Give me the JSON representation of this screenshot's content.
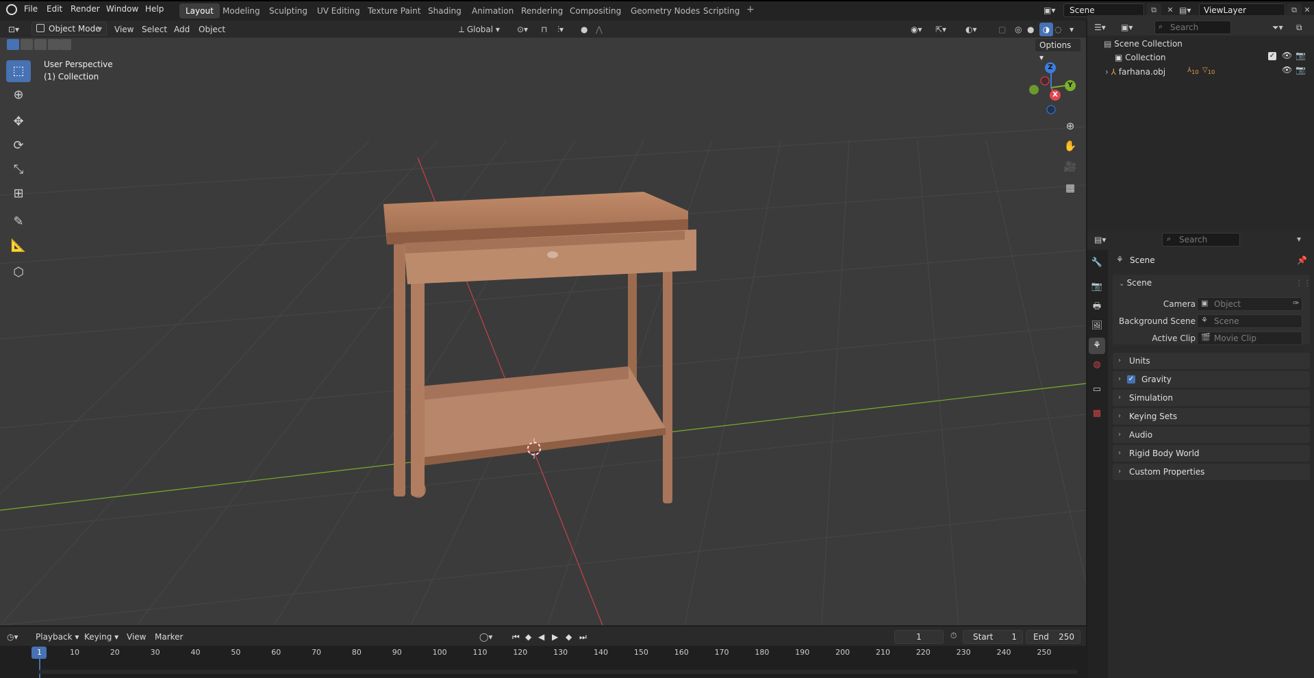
{
  "menu": [
    "File",
    "Edit",
    "Render",
    "Window",
    "Help"
  ],
  "workspaces": [
    "Layout",
    "Modeling",
    "Sculpting",
    "UV Editing",
    "Texture Paint",
    "Shading",
    "Animation",
    "Rendering",
    "Compositing",
    "Geometry Nodes",
    "Scripting"
  ],
  "active_workspace": "Layout",
  "scene_name": "Scene",
  "view_layer": "ViewLayer",
  "viewport_header": {
    "mode": "Object Mode",
    "menus": [
      "View",
      "Select",
      "Add",
      "Object"
    ],
    "transform_orientation": "Global",
    "options_label": "Options"
  },
  "overlay_text": {
    "perspective": "User Perspective",
    "collection": "(1) Collection"
  },
  "gizmo": {
    "x": "X",
    "y": "Y",
    "z": "Z"
  },
  "outliner": {
    "search_placeholder": "Search",
    "rows": [
      "Scene Collection",
      "Collection",
      "farhana.obj"
    ],
    "badges": [
      "10",
      "10"
    ]
  },
  "properties": {
    "search_placeholder": "Search",
    "context": "Scene",
    "section_title": "Scene",
    "fields": [
      {
        "label": "Camera",
        "placeholder": "Object"
      },
      {
        "label": "Background Scene",
        "placeholder": "Scene"
      },
      {
        "label": "Active Clip",
        "placeholder": "Movie Clip"
      }
    ],
    "panels": [
      "Units",
      "Gravity",
      "Simulation",
      "Keying Sets",
      "Audio",
      "Rigid Body World",
      "Custom Properties"
    ],
    "gravity_enabled": true
  },
  "timeline": {
    "menus": [
      "Playback",
      "Keying",
      "View",
      "Marker"
    ],
    "current_frame": "1",
    "start_label": "Start",
    "start": "1",
    "end_label": "End",
    "end": "250",
    "ticks": [
      "1",
      "10",
      "20",
      "30",
      "40",
      "50",
      "60",
      "70",
      "80",
      "90",
      "100",
      "110",
      "120",
      "130",
      "140",
      "150",
      "160",
      "170",
      "180",
      "190",
      "200",
      "210",
      "220",
      "230",
      "240",
      "250"
    ]
  },
  "colors": {
    "accent": "#4772b3",
    "x_axis": "#e0474f",
    "y_axis": "#7bb02a",
    "z_axis": "#3c7ee0",
    "wood": "#b07a5a"
  }
}
